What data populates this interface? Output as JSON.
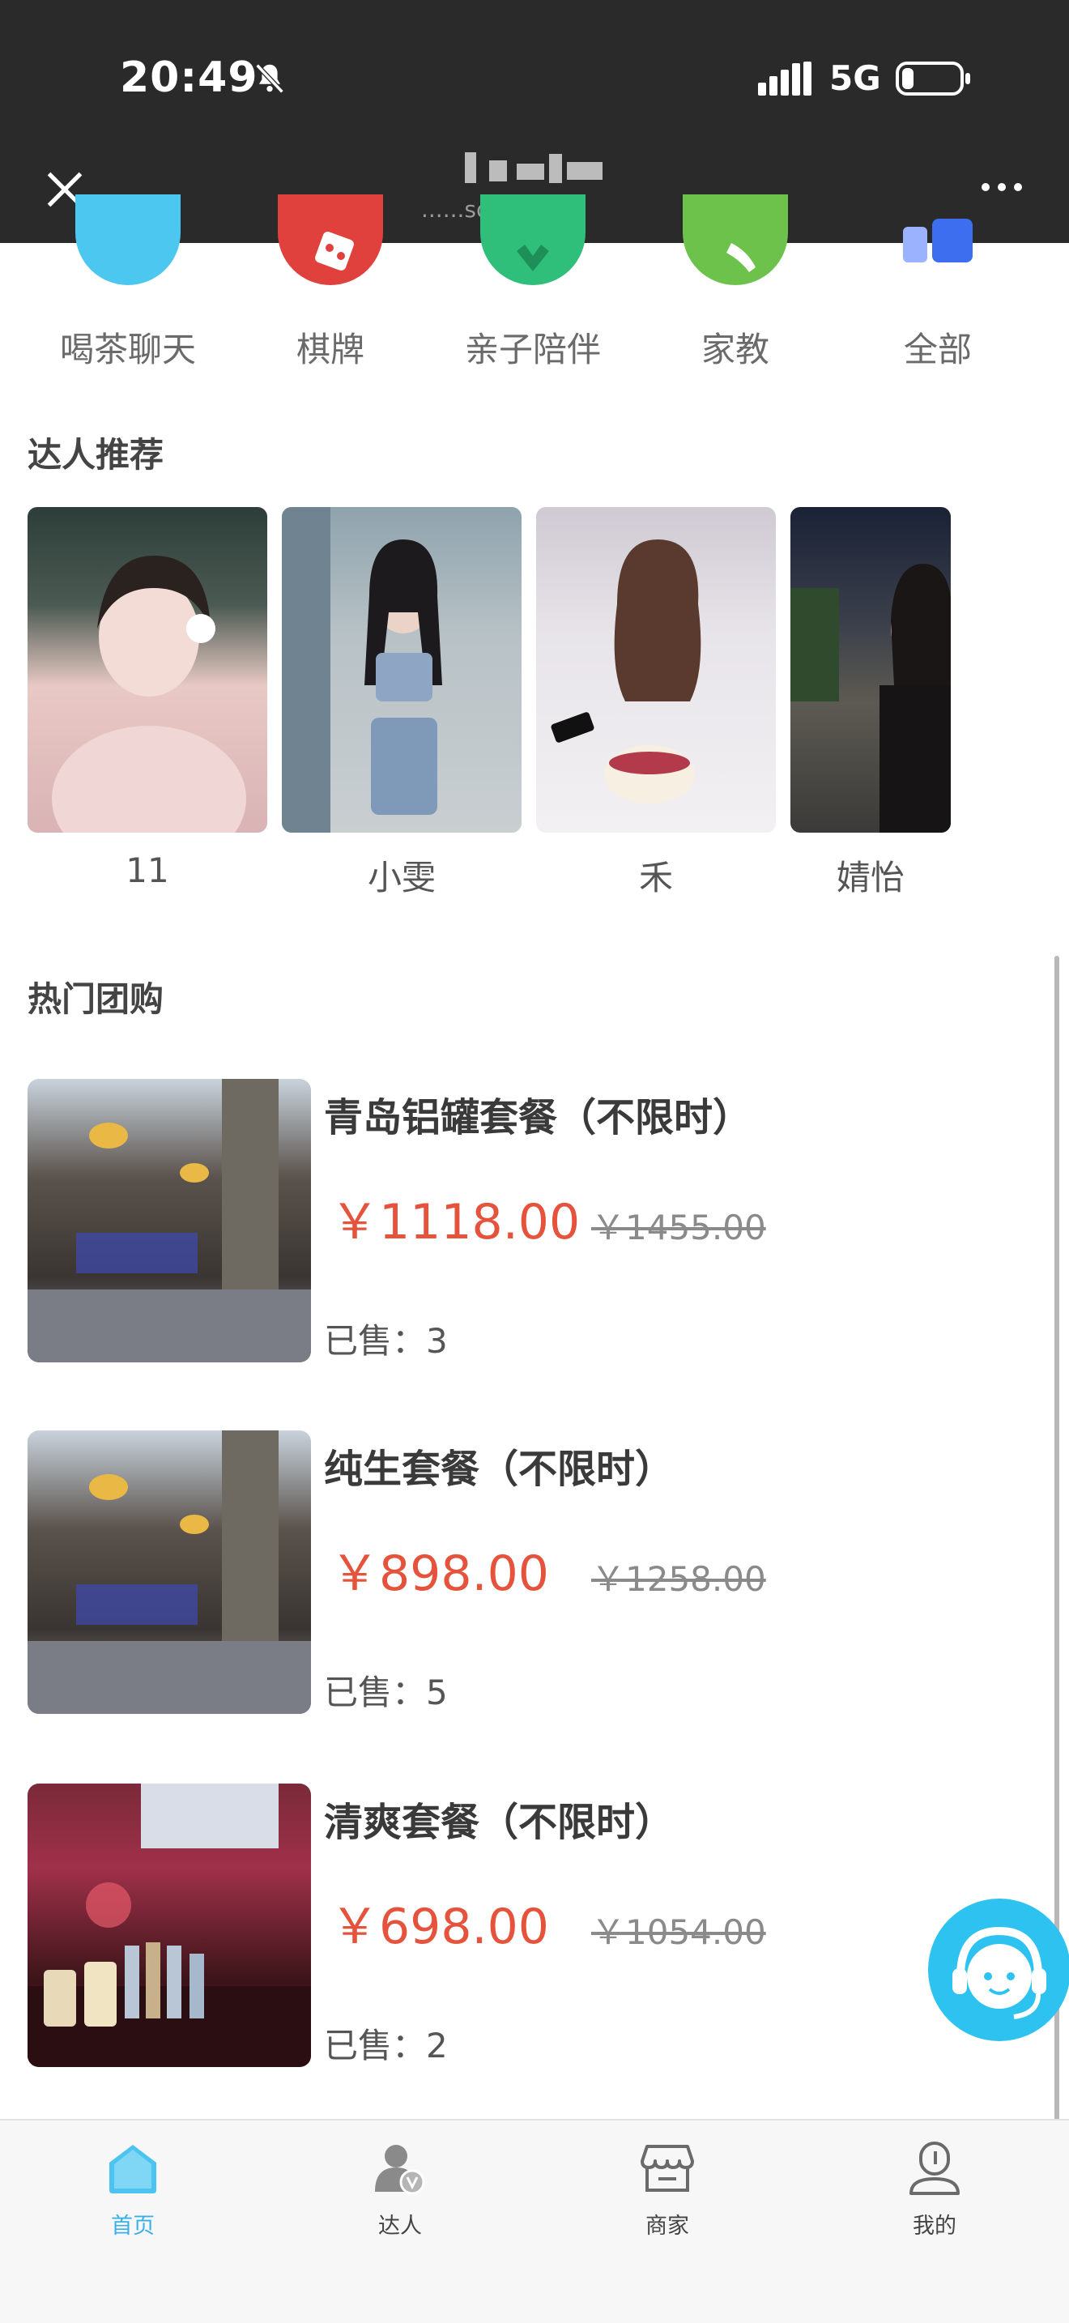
{
  "status_bar": {
    "time": "20:49",
    "network": "5G"
  },
  "header": {
    "subtitle": "......sou.com"
  },
  "categories": [
    {
      "label": "喝茶聊天",
      "icon": "tea-icon",
      "color": "#4cc7f0"
    },
    {
      "label": "棋牌",
      "icon": "cards-icon",
      "color": "#e0413d"
    },
    {
      "label": "亲子陪伴",
      "icon": "family-icon",
      "color": "#2fbf7a"
    },
    {
      "label": "家教",
      "icon": "tutor-icon",
      "color": "#6cc24a"
    },
    {
      "label": "全部",
      "icon": "all-icon",
      "color": "#3d6ef0"
    }
  ],
  "talent_section": {
    "title": "达人推荐"
  },
  "talents": [
    {
      "name": "11"
    },
    {
      "name": "小雯"
    },
    {
      "name": "禾"
    },
    {
      "name": "婧怡"
    }
  ],
  "deals_section": {
    "title": "热门团购"
  },
  "deals": [
    {
      "title": "青岛铝罐套餐（不限时）",
      "price": "￥1118.00",
      "original_price": "￥1455.00",
      "sold": "已售：3"
    },
    {
      "title": "纯生套餐（不限时）",
      "price": "￥898.00",
      "original_price": "￥1258.00",
      "sold": "已售：5"
    },
    {
      "title": "清爽套餐（不限时）",
      "price": "￥698.00",
      "original_price": "￥1054.00",
      "sold": "已售：2"
    }
  ],
  "tabbar": [
    {
      "label": "首页",
      "icon": "home-icon",
      "active": true
    },
    {
      "label": "达人",
      "icon": "talent-icon",
      "active": false
    },
    {
      "label": "商家",
      "icon": "shop-icon",
      "active": false
    },
    {
      "label": "我的",
      "icon": "profile-icon",
      "active": false
    }
  ],
  "colors": {
    "accent": "#39b1e8",
    "price": "#e5533d",
    "header_bg": "#2a2a2a"
  }
}
